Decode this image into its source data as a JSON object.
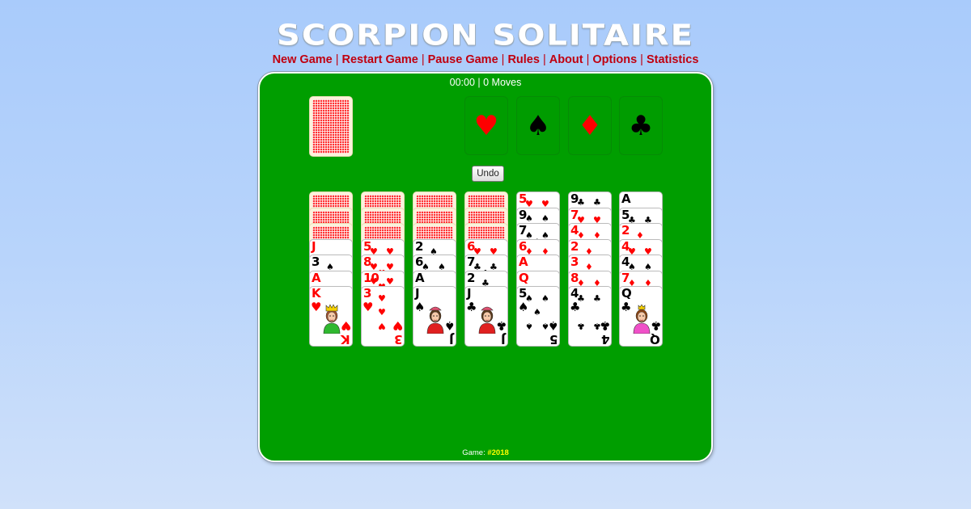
{
  "title": "SCORPION SOLITAIRE",
  "menu": [
    {
      "label": "New Game",
      "id": "new-game"
    },
    {
      "label": "Restart Game",
      "id": "restart-game"
    },
    {
      "label": "Pause Game",
      "id": "pause-game"
    },
    {
      "label": "Rules",
      "id": "rules"
    },
    {
      "label": "About",
      "id": "about"
    },
    {
      "label": "Options",
      "id": "options"
    },
    {
      "label": "Statistics",
      "id": "statistics"
    }
  ],
  "menu_separator": "|",
  "status": {
    "time": "00:00",
    "moves": "0 Moves",
    "text": "00:00 | 0 Moves"
  },
  "undo_label": "Undo",
  "stock": {
    "face_down_count": 1
  },
  "foundations": [
    {
      "suit": "hearts",
      "glyph": "♥",
      "color": "#ff0000"
    },
    {
      "suit": "spades",
      "glyph": "♠",
      "color": "#000000"
    },
    {
      "suit": "diamonds",
      "glyph": "♦",
      "color": "#ff0000"
    },
    {
      "suit": "clubs",
      "glyph": "♣",
      "color": "#000000"
    }
  ],
  "tableau": [
    {
      "face_down": 3,
      "cards": [
        {
          "rank": "J",
          "suit": "♥"
        },
        {
          "rank": "3",
          "suit": "♠"
        },
        {
          "rank": "A",
          "suit": "♥"
        },
        {
          "rank": "K",
          "suit": "♥"
        }
      ]
    },
    {
      "face_down": 3,
      "cards": [
        {
          "rank": "5",
          "suit": "♥"
        },
        {
          "rank": "8",
          "suit": "♥"
        },
        {
          "rank": "10",
          "suit": "♥"
        },
        {
          "rank": "3",
          "suit": "♥"
        }
      ]
    },
    {
      "face_down": 3,
      "cards": [
        {
          "rank": "2",
          "suit": "♠"
        },
        {
          "rank": "6",
          "suit": "♠"
        },
        {
          "rank": "A",
          "suit": "♠"
        },
        {
          "rank": "J",
          "suit": "♠"
        }
      ]
    },
    {
      "face_down": 3,
      "cards": [
        {
          "rank": "6",
          "suit": "♥"
        },
        {
          "rank": "7",
          "suit": "♣"
        },
        {
          "rank": "2",
          "suit": "♣"
        },
        {
          "rank": "J",
          "suit": "♣"
        }
      ]
    },
    {
      "face_down": 0,
      "cards": [
        {
          "rank": "5",
          "suit": "♥"
        },
        {
          "rank": "9",
          "suit": "♠"
        },
        {
          "rank": "7",
          "suit": "♠"
        },
        {
          "rank": "6",
          "suit": "♦"
        },
        {
          "rank": "A",
          "suit": "♦"
        },
        {
          "rank": "Q",
          "suit": "♦"
        },
        {
          "rank": "5",
          "suit": "♠"
        }
      ]
    },
    {
      "face_down": 0,
      "cards": [
        {
          "rank": "9",
          "suit": "♣"
        },
        {
          "rank": "7",
          "suit": "♥"
        },
        {
          "rank": "4",
          "suit": "♦"
        },
        {
          "rank": "2",
          "suit": "♦"
        },
        {
          "rank": "3",
          "suit": "♦"
        },
        {
          "rank": "8",
          "suit": "♦"
        },
        {
          "rank": "4",
          "suit": "♣"
        }
      ]
    },
    {
      "face_down": 0,
      "cards": [
        {
          "rank": "A",
          "suit": "♣"
        },
        {
          "rank": "5",
          "suit": "♣"
        },
        {
          "rank": "2",
          "suit": "♦"
        },
        {
          "rank": "4",
          "suit": "♥"
        },
        {
          "rank": "4",
          "suit": "♠"
        },
        {
          "rank": "7",
          "suit": "♦"
        },
        {
          "rank": "Q",
          "suit": "♣"
        }
      ]
    }
  ],
  "footer": {
    "label": "Game:",
    "number": "#2018"
  },
  "colors": {
    "felt": "#009e00",
    "menu_link": "#c00010",
    "game_number": "#ffff00",
    "red_suit": "#ff0000"
  }
}
